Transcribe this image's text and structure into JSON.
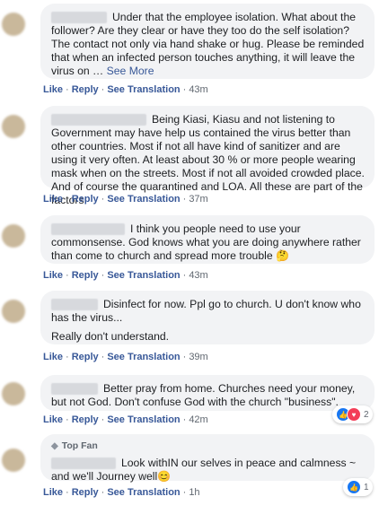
{
  "actions": {
    "like": "Like",
    "reply": "Reply",
    "see_translation": "See Translation",
    "separator": "·"
  },
  "comments": [
    {
      "text": "Under that the employee isolation. What about the follower? Are they clear or have they too do the self isolation? The contact not only via hand shake or hug. Please be reminded that when an infected person touches anything, it will leave the virus on … ",
      "see_more": "See More",
      "time": "43m"
    },
    {
      "text": "Being Kiasi, Kiasu and not listening to Government may have help us contained the virus better than other countries. Most if not all have kind of sanitizer and are using it very often. At least about 30 % or more people wearing mask when on the streets. Most if not all avoided crowded place. And of course the quarantined and LOA. All these are part of the factors.",
      "time": "37m"
    },
    {
      "text": "I think you people need to use your commonsense. God knows what you are doing anywhere rather than come to church and spread more trouble ",
      "emoji": "🤔",
      "time": "43m"
    },
    {
      "text": "Disinfect for now. Ppl go to church. U don't know who has the virus...",
      "text2": "Really don't understand.",
      "time": "39m"
    },
    {
      "text": "Better pray from home. Churches need your money, but not God. Don't confuse God with the church \"business\".",
      "time": "42m",
      "reaction_count": "2"
    },
    {
      "badge": "Top Fan",
      "text": "Look withIN our selves in peace and calmness ~ and we'll Journey well",
      "emoji": "😊",
      "time": "1h",
      "reaction_count": "1"
    }
  ]
}
